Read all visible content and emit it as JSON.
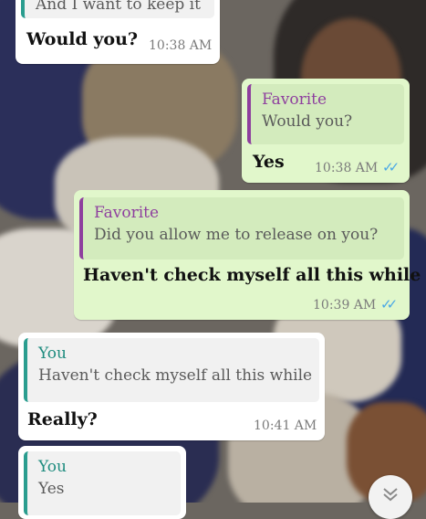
{
  "messages": [
    {
      "id": "m1",
      "quote_text": "And I want to keep it",
      "text": "Would you?",
      "time": "10:38 AM"
    },
    {
      "id": "m2",
      "quote_name": "Favorite",
      "quote_text": "Would you?",
      "text": "Yes",
      "time": "10:38 AM",
      "status": "read"
    },
    {
      "id": "m3",
      "quote_name": "Favorite",
      "quote_text": "Did you allow me to release on you?",
      "text": "Haven't check myself all this while",
      "time": "10:39 AM",
      "status": "read"
    },
    {
      "id": "m4",
      "quote_name": "You",
      "quote_text": "Haven't check myself all this while",
      "text": "Really?",
      "time": "10:41 AM"
    },
    {
      "id": "m5",
      "quote_name": "You",
      "quote_text": "Yes"
    }
  ],
  "colors": {
    "incoming_bubble": "#ffffff",
    "outgoing_bubble": "#e1f7cb",
    "quote_bar_you": "#2a9d8f",
    "quote_bar_favorite": "#8e3f9e",
    "read_ticks": "#4aa8e6"
  },
  "icons": {
    "read_receipt": "double-check-icon",
    "scroll_down": "chevron-down-icon"
  }
}
